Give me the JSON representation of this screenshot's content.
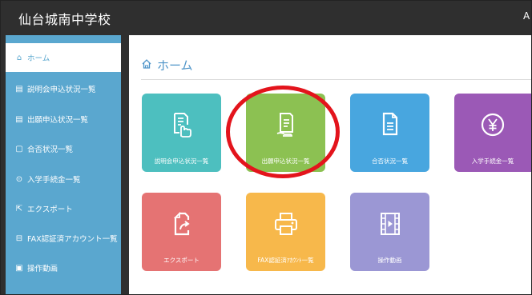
{
  "header": {
    "title": "仙台城南中学校",
    "user_glyph": "A"
  },
  "sidebar": {
    "items": [
      {
        "label": "ホーム",
        "icon": "home-icon",
        "glyph": "⌂"
      },
      {
        "label": "説明会申込状況一覧",
        "icon": "document-hand-icon",
        "glyph": "▤"
      },
      {
        "label": "出願申込状況一覧",
        "icon": "document-icon",
        "glyph": "▤"
      },
      {
        "label": "合否状況一覧",
        "icon": "file-icon",
        "glyph": "▢"
      },
      {
        "label": "入学手続金一覧",
        "icon": "yen-icon",
        "glyph": "⊙"
      },
      {
        "label": "エクスポート",
        "icon": "export-icon",
        "glyph": "⇱"
      },
      {
        "label": "FAX認証済アカウント一覧",
        "icon": "printer-icon",
        "glyph": "⊟"
      },
      {
        "label": "操作動画",
        "icon": "film-icon",
        "glyph": "▣"
      }
    ]
  },
  "main": {
    "title": "ホーム",
    "title_icon": "home-icon",
    "tiles": [
      {
        "label": "説明会申込状況一覧",
        "icon": "document-hand-icon",
        "color": "#4dbfbf"
      },
      {
        "label": "出願申込状況一覧",
        "icon": "document-hand-icon",
        "color": "#8cc152"
      },
      {
        "label": "合否状況一覧",
        "icon": "file-icon",
        "color": "#48a6df"
      },
      {
        "label": "入学手続金一覧",
        "icon": "yen-icon",
        "color": "#9b59b6"
      },
      {
        "label": "エクスポート",
        "icon": "export-icon",
        "color": "#e57373"
      },
      {
        "label": "FAX認証済ｱｶｳﾝﾄ一覧",
        "icon": "printer-icon",
        "color": "#f7b84b"
      },
      {
        "label": "操作動画",
        "icon": "film-icon",
        "color": "#9b97d4"
      }
    ]
  },
  "colors": {
    "accent": "#5aa7cf",
    "header_bg": "#2f2f2f",
    "highlight_circle": "#e3141c"
  }
}
